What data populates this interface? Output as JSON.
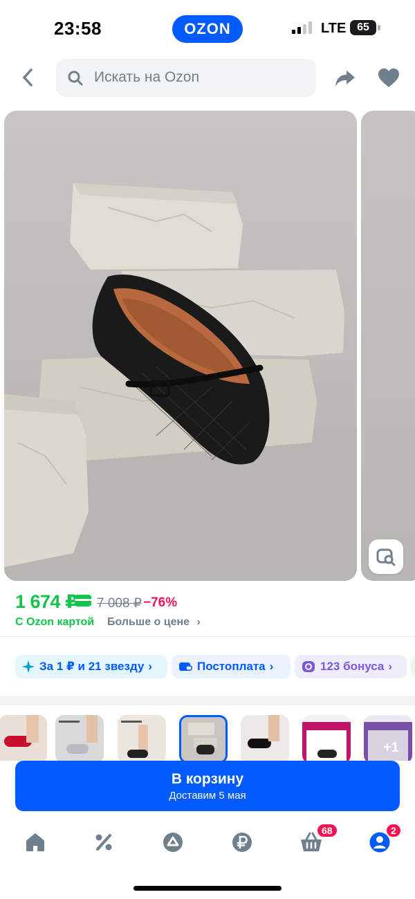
{
  "status_bar": {
    "time": "23:58",
    "network": "LTE",
    "battery": "65"
  },
  "header": {
    "logo": "OZON"
  },
  "search": {
    "placeholder": "Искать на Ozon"
  },
  "price": {
    "current": "1 674 ₽",
    "old": "7 008 ₽",
    "discount": "−76%",
    "card_label": "С Ozon картой",
    "more_label": "Больше о цене"
  },
  "chips": {
    "stars": "За 1 ₽ и 21 звезду",
    "postpay": "Постоплата",
    "bonus": "123 бонуса"
  },
  "variants": {
    "more_count": "+1"
  },
  "cta": {
    "title": "В корзину",
    "subtitle": "Доставим 5 мая"
  },
  "tabbar": {
    "cart_badge": "68",
    "profile_badge": "2"
  },
  "colors": {
    "accent": "#005bff",
    "price_green": "#10c44c",
    "discount_red": "#f91155"
  }
}
